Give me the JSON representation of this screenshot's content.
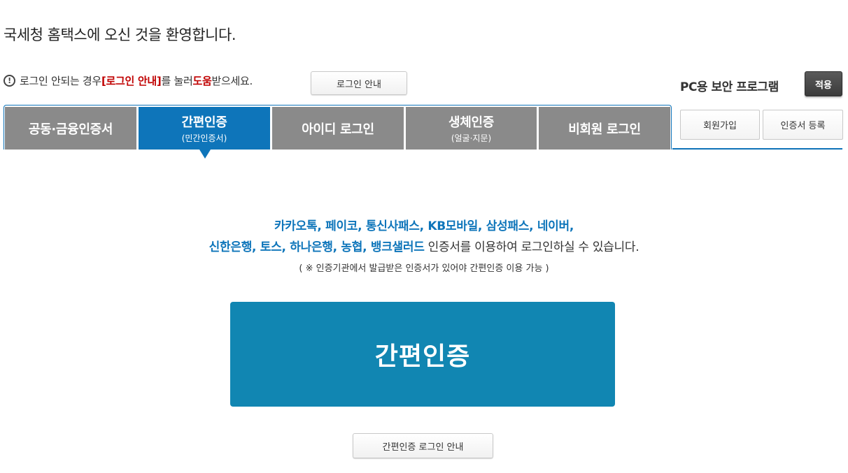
{
  "header": {
    "welcome": "국세청 홈택스에 오신 것을 환영합니다."
  },
  "notice": {
    "icon": "exclamation-circle-icon",
    "part1": "로그인 안되는 경우 ",
    "highlight1": "[로그인 안내]",
    "part2": "를 눌러 ",
    "highlight2": "도움",
    "part3": "받으세요.",
    "button_label": "로그인 안내"
  },
  "security": {
    "label": "PC용 보안 프로그램",
    "apply_label": "적용"
  },
  "tabs": [
    {
      "label": "공동·금융인증서",
      "sub": ""
    },
    {
      "label": "간편인증",
      "sub": "(민간인증서)"
    },
    {
      "label": "아이디 로그인",
      "sub": ""
    },
    {
      "label": "생체인증",
      "sub": "(얼굴·지문)"
    },
    {
      "label": "비회원 로그인",
      "sub": ""
    }
  ],
  "side_buttons": {
    "signup": "회원가입",
    "cert_register": "인증서 등록"
  },
  "content": {
    "providers_line1": "카카오톡, 페이코, 통신사패스, KB모바일, 삼성패스, 네이버,",
    "providers_line2": "신한은행, 토스, 하나은행, 농협, 뱅크샐러드",
    "line2_rest": " 인증서를 이용하여 로그인하실 수 있습니다.",
    "note": "( ※ 인증기관에서 발급받은 인증서가 있어야 간편인증 이용 가능 )",
    "main_button": "간편인증",
    "guide_button": "간편인증 로그인 안내"
  },
  "colors": {
    "accent": "#0e75ba",
    "main_button": "#1186b2",
    "inactive_tab": "#8a8a8a",
    "highlight_red": "#c00000"
  }
}
